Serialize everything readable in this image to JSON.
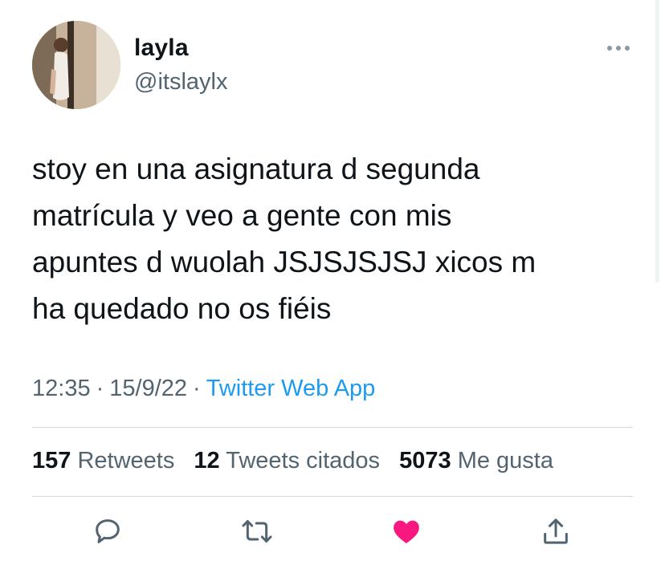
{
  "user": {
    "display_name": "layla",
    "handle": "@itslaylx"
  },
  "tweet": {
    "text": "stoy en una asignatura d segunda\nmatrícula y veo a gente con mis\napuntes d wuolah JSJSJSJSJ xicos m\nha quedado no os fiéis",
    "time": "12:35",
    "date": "15/9/22",
    "separator": "·",
    "source": "Twitter Web App"
  },
  "stats": {
    "retweets_count": "157",
    "retweets_label": "Retweets",
    "quotes_count": "12",
    "quotes_label": "Tweets citados",
    "likes_count": "5073",
    "likes_label": "Me gusta"
  },
  "actions": {
    "reply_icon": "reply-icon",
    "retweet_icon": "retweet-icon",
    "like_icon": "heart-icon",
    "share_icon": "share-icon",
    "liked": true
  },
  "colors": {
    "text": "#0f1419",
    "secondary": "#536471",
    "link": "#1d9bf0",
    "like": "#f91880",
    "divider": "#cfd9de"
  }
}
